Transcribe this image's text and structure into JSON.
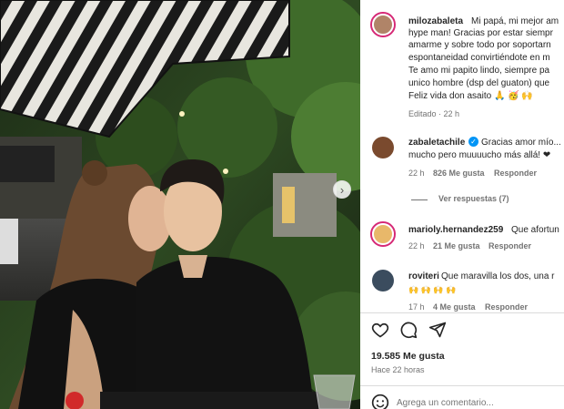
{
  "post": {
    "author": "milozabaleta",
    "caption_lines": [
      "Mi papá, mi mejor am",
      "hype man! Gracias por estar siempr",
      "amarme y sobre todo por soportarn",
      "espontaneidad convirtiéndote en m",
      "Te amo mi papito lindo, siempre pa",
      "unico hombre (dsp del guaton) que",
      "Feliz vida don asaito 🙏 🥳 🙌"
    ],
    "caption_meta": "Editado · 22 h"
  },
  "comments": [
    {
      "user": "zabaletachile",
      "verified": true,
      "lines": [
        "Gracias amor mío...",
        "mucho pero muuuucho más allá! ❤"
      ],
      "time": "22 h",
      "likes": "826 Me gusta",
      "reply": "Responder",
      "view_replies": "Ver respuestas (7)",
      "avatar_color": "#7a4a2e"
    },
    {
      "user": "marioly.hernandez259",
      "verified": false,
      "lines": [
        "Que afortun"
      ],
      "time": "22 h",
      "likes": "21 Me gusta",
      "reply": "Responder",
      "avatar_color": "#e8b86a"
    },
    {
      "user": "roviteri",
      "verified": false,
      "lines": [
        "Que maravilla los dos, una r",
        "🙌 🙌 🙌 🙌"
      ],
      "time": "17 h",
      "likes": "4 Me gusta",
      "reply": "Responder",
      "avatar_color": "#3b4c5e"
    }
  ],
  "actions": {
    "like_icon": "heart-icon",
    "comment_icon": "comment-icon",
    "share_icon": "share-icon",
    "likes_count": "19.585 Me gusta",
    "posted": "Hace 22 horas"
  },
  "comment_box": {
    "placeholder": "Agrega un comentario..."
  },
  "colors": {
    "accent": "#0095f6",
    "story_ring": "#d62976",
    "heart_red": "#ed4956"
  }
}
